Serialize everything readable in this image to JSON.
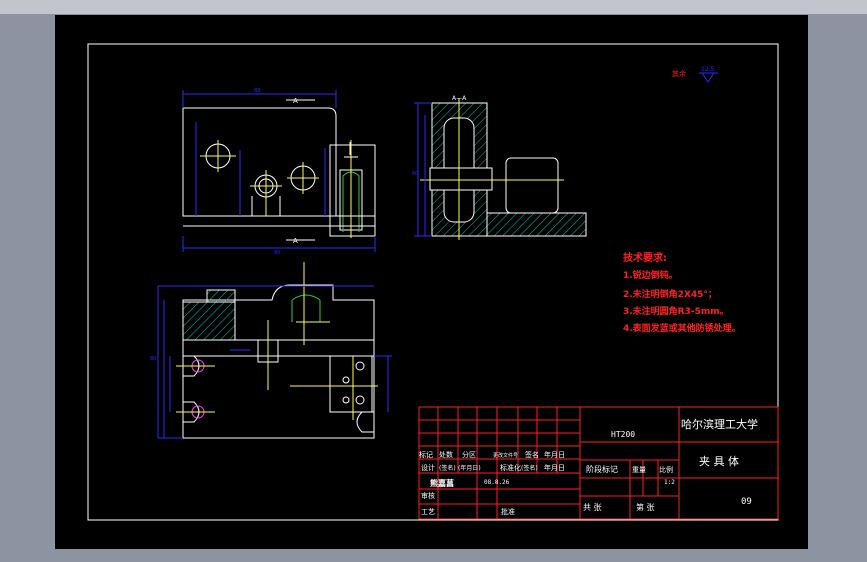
{
  "drawing": {
    "roughness_label": "其余",
    "roughness_value": "12.5"
  },
  "views": {
    "front_top_dim": "88",
    "front_bottom_dim": "90",
    "section_top_label": "A",
    "section_bottom_label": "A",
    "side_top_label": "A—A",
    "side_height_dim": "60",
    "plan_height_dim": "80"
  },
  "technical_requirements": {
    "heading": "技术要求:",
    "items": [
      "1.锐边倒钝。",
      "2.未注明倒角2X45°；",
      "3.未注明圆角R3-5mm。",
      "4.表面发蓝或其他防锈处理。"
    ]
  },
  "title_block": {
    "material": "HT200",
    "school": "哈尔滨理工大学",
    "part_name": "夹 具 体",
    "drawing_no": "09",
    "row_mark": [
      "标记",
      "处数",
      "分区",
      "更改文件号",
      "签名",
      "年月日"
    ],
    "row_design": [
      "设计",
      "(签名)",
      "(年月日)",
      "标准化",
      "(签名)",
      "年月日"
    ],
    "designer": "熊嘉菖",
    "date": "08.8.26",
    "stage_label": "阶段标记",
    "weight_label": "重量",
    "scale_label": "比例",
    "scale_value": "1:2",
    "review_label": "审核",
    "process_label": "工艺",
    "approve_label": "批准",
    "sheet_total": "共 张",
    "sheet_no": "第 张"
  },
  "colors": {
    "sheet": "#000000",
    "line": "#ffffff",
    "dimension": "#2a2aff",
    "centerline": "#ffff40",
    "hatch": "#00c0c0",
    "magenta": "#ff40ff",
    "text_red": "#ff2020",
    "green": "#30d030"
  }
}
